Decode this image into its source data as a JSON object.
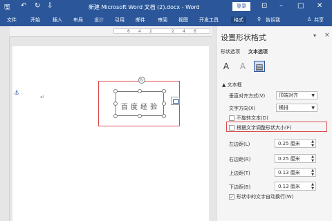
{
  "titlebar": {
    "title": "新建 Microsoft Word 文档 (2).docx - Word",
    "login_label": "登录",
    "qa_save": "🖫",
    "qa_undo": "↶",
    "qa_redo": "↻",
    "qa_more": "⇩",
    "ctrl_ribbon": "⊡",
    "ctrl_min": "–",
    "ctrl_max": "□",
    "ctrl_close": "✕"
  },
  "ribbon": {
    "tabs": [
      "文件",
      "开始",
      "插入",
      "布局",
      "设计",
      "引用",
      "邮件",
      "审阅",
      "视图",
      "开发工具",
      "格式"
    ],
    "tell_me": "告诉我",
    "share": "共享",
    "tell_me_icon": "♀",
    "share_icon": "♙"
  },
  "ruler": {
    "ticks": [
      "6",
      "4",
      "2",
      "",
      "2",
      "4",
      "6"
    ]
  },
  "document": {
    "anchor": "⚓",
    "para_mark": "↵",
    "textbox_text": "百度经验"
  },
  "pane": {
    "title": "设置形状格式",
    "pin": "▾",
    "close": "×",
    "tabs": [
      "形状选项",
      "文本选项"
    ],
    "icons": [
      "A",
      "A",
      "▤"
    ],
    "section": "▲ 文本框",
    "vertical_align_label": "垂直对齐方式(V)",
    "vertical_align_value": "顶端对齐",
    "text_direction_label": "文字方向(X)",
    "text_direction_value": "横排",
    "no_rotate_label": "不旋转文本(D)",
    "autofit_label": "根据文字调整形状大小(F)",
    "margins": [
      {
        "label": "左边距(L)",
        "value": "0.25 厘米"
      },
      {
        "label": "右边距(R)",
        "value": "0.25 厘米"
      },
      {
        "label": "上边距(T)",
        "value": "0.13 厘米"
      },
      {
        "label": "下边距(B)",
        "value": "0.13 厘米"
      }
    ],
    "wrap_label": "形状中的文字自动换行(W)",
    "wrap_check": "✓"
  }
}
